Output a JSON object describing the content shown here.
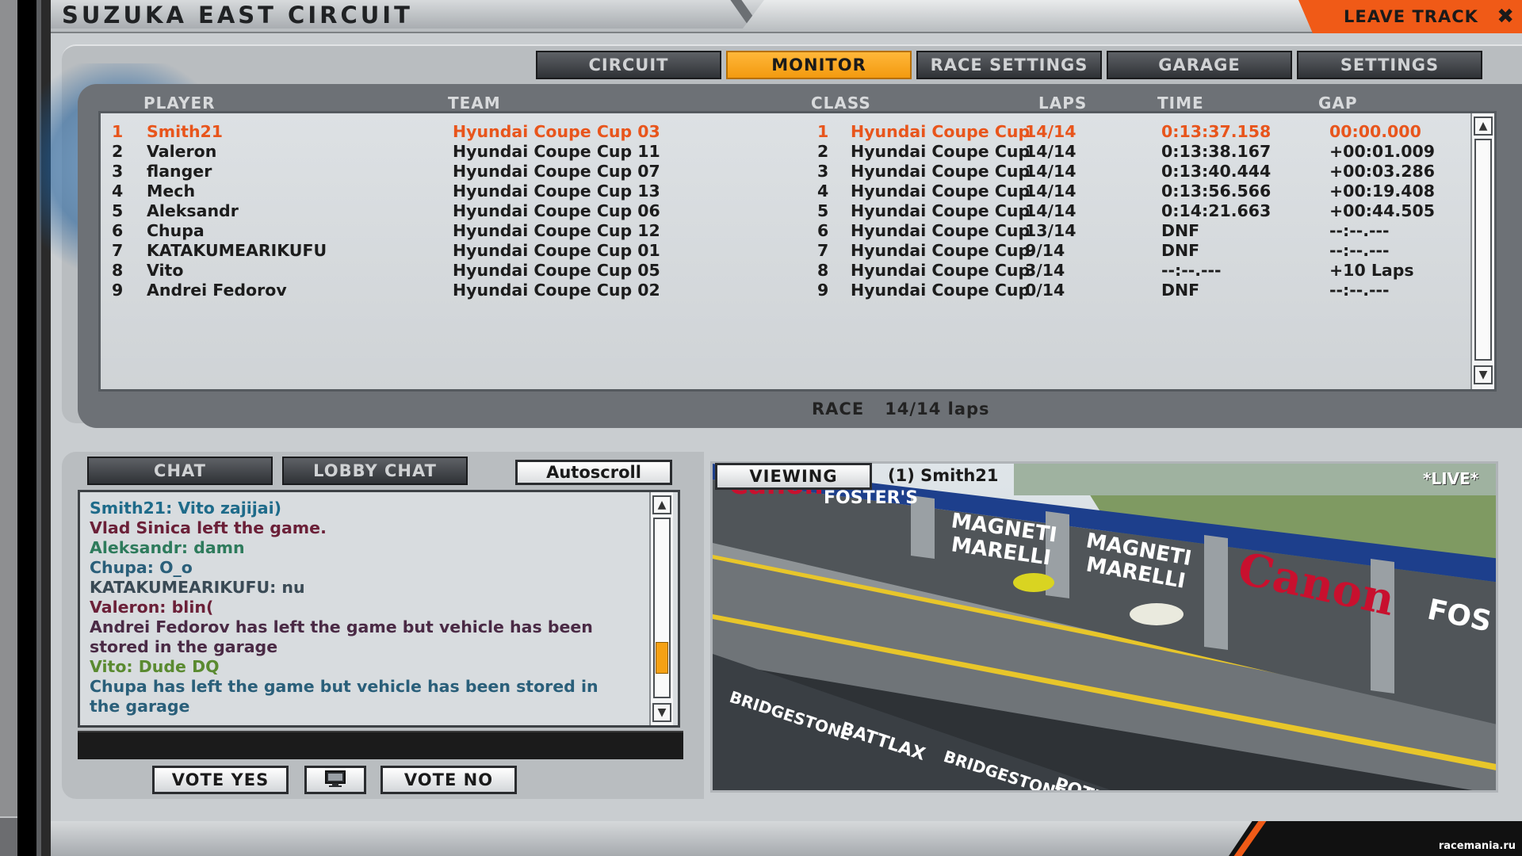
{
  "window": {
    "title": "SUZUKA EAST CIRCUIT",
    "leave_track_label": "LEAVE TRACK",
    "close_icon": "close-icon"
  },
  "tabs": [
    {
      "label": "CIRCUIT",
      "active": false
    },
    {
      "label": "MONITOR",
      "active": true
    },
    {
      "label": "RACE SETTINGS",
      "active": false
    },
    {
      "label": "GARAGE",
      "active": false
    },
    {
      "label": "SETTINGS",
      "active": false
    }
  ],
  "results": {
    "columns": {
      "player": "PLAYER",
      "team": "TEAM",
      "class": "CLASS",
      "laps": "LAPS",
      "time": "TIME",
      "gap": "GAP"
    },
    "rows": [
      {
        "pos": "1",
        "player": "Smith21",
        "team": "Hyundai Coupe Cup 03",
        "class_pos": "1",
        "class": "Hyundai Coupe Cup",
        "laps": "14/14",
        "time": "0:13:37.158",
        "gap": "00:00.000"
      },
      {
        "pos": "2",
        "player": "Valeron",
        "team": "Hyundai Coupe Cup 11",
        "class_pos": "2",
        "class": "Hyundai Coupe Cup",
        "laps": "14/14",
        "time": "0:13:38.167",
        "gap": "+00:01.009"
      },
      {
        "pos": "3",
        "player": "flanger",
        "team": "Hyundai Coupe Cup 07",
        "class_pos": "3",
        "class": "Hyundai Coupe Cup",
        "laps": "14/14",
        "time": "0:13:40.444",
        "gap": "+00:03.286"
      },
      {
        "pos": "4",
        "player": "Mech",
        "team": "Hyundai Coupe Cup 13",
        "class_pos": "4",
        "class": "Hyundai Coupe Cup",
        "laps": "14/14",
        "time": "0:13:56.566",
        "gap": "+00:19.408"
      },
      {
        "pos": "5",
        "player": "Aleksandr",
        "team": "Hyundai Coupe Cup 06",
        "class_pos": "5",
        "class": "Hyundai Coupe Cup",
        "laps": "14/14",
        "time": "0:14:21.663",
        "gap": "+00:44.505"
      },
      {
        "pos": "6",
        "player": "Chupa",
        "team": "Hyundai Coupe Cup 12",
        "class_pos": "6",
        "class": "Hyundai Coupe Cup",
        "laps": "13/14",
        "time": "DNF",
        "gap": "--:--.---"
      },
      {
        "pos": "7",
        "player": "KATAKUMEARIKUFU",
        "team": "Hyundai Coupe Cup 01",
        "class_pos": "7",
        "class": "Hyundai Coupe Cup",
        "laps": "9/14",
        "time": "DNF",
        "gap": "--:--.---"
      },
      {
        "pos": "8",
        "player": "Vito",
        "team": "Hyundai Coupe Cup 05",
        "class_pos": "8",
        "class": "Hyundai Coupe Cup",
        "laps": "3/14",
        "time": "--:--.---",
        "gap": "+10 Laps"
      },
      {
        "pos": "9",
        "player": "Andrei Fedorov",
        "team": "Hyundai Coupe Cup 02",
        "class_pos": "9",
        "class": "Hyundai Coupe Cup",
        "laps": "0/14",
        "time": "DNF",
        "gap": "--:--.---"
      }
    ],
    "highlight_color": "#e8551c"
  },
  "race_status": {
    "session": "RACE",
    "laps": "14/14 laps"
  },
  "chat": {
    "tab_chat": "CHAT",
    "tab_lobby": "LOBBY CHAT",
    "autoscroll_label": "Autoscroll",
    "messages": [
      {
        "text": "Smith21: Vito zajijai)",
        "color": "#1e6b8a"
      },
      {
        "text": "Vlad Sinica left the game.",
        "color": "#6b2038"
      },
      {
        "text": "Aleksandr: damn",
        "color": "#2e7b5c"
      },
      {
        "text": "Chupa: O_o",
        "color": "#2a5f7a"
      },
      {
        "text": "KATAKUMEARIKUFU: nu",
        "color": "#3a4a55"
      },
      {
        "text": "Valeron: blin(",
        "color": "#6b2038"
      },
      {
        "text": "Andrei Fedorov has left the game but vehicle has been",
        "color": "#4a2a45"
      },
      {
        "text": "stored in the garage",
        "color": "#4a2a45"
      },
      {
        "text": "Vito: Dude DQ",
        "color": "#5a8a30"
      },
      {
        "text": "Chupa has left the game but vehicle has been stored in",
        "color": "#2a5f7a"
      },
      {
        "text": "the garage",
        "color": "#2a5f7a"
      }
    ],
    "scroll_position": 0.85
  },
  "vote": {
    "yes_label": "VOTE YES",
    "no_label": "VOTE NO",
    "monitor_icon": "monitor-icon"
  },
  "viewer": {
    "viewing_label": "VIEWING",
    "target": "(1) Smith21",
    "live_label": "*LIVE*",
    "signage": [
      "Canon",
      "FOSTER'S",
      "MAGNETI MARELLI",
      "MAGNETI MARELLI",
      "Canon",
      "FOS",
      "BRIDGESTONE",
      "BATTLAX",
      "BRIDGESTONE",
      "POTENZA"
    ]
  },
  "watermark": "racemania.ru"
}
